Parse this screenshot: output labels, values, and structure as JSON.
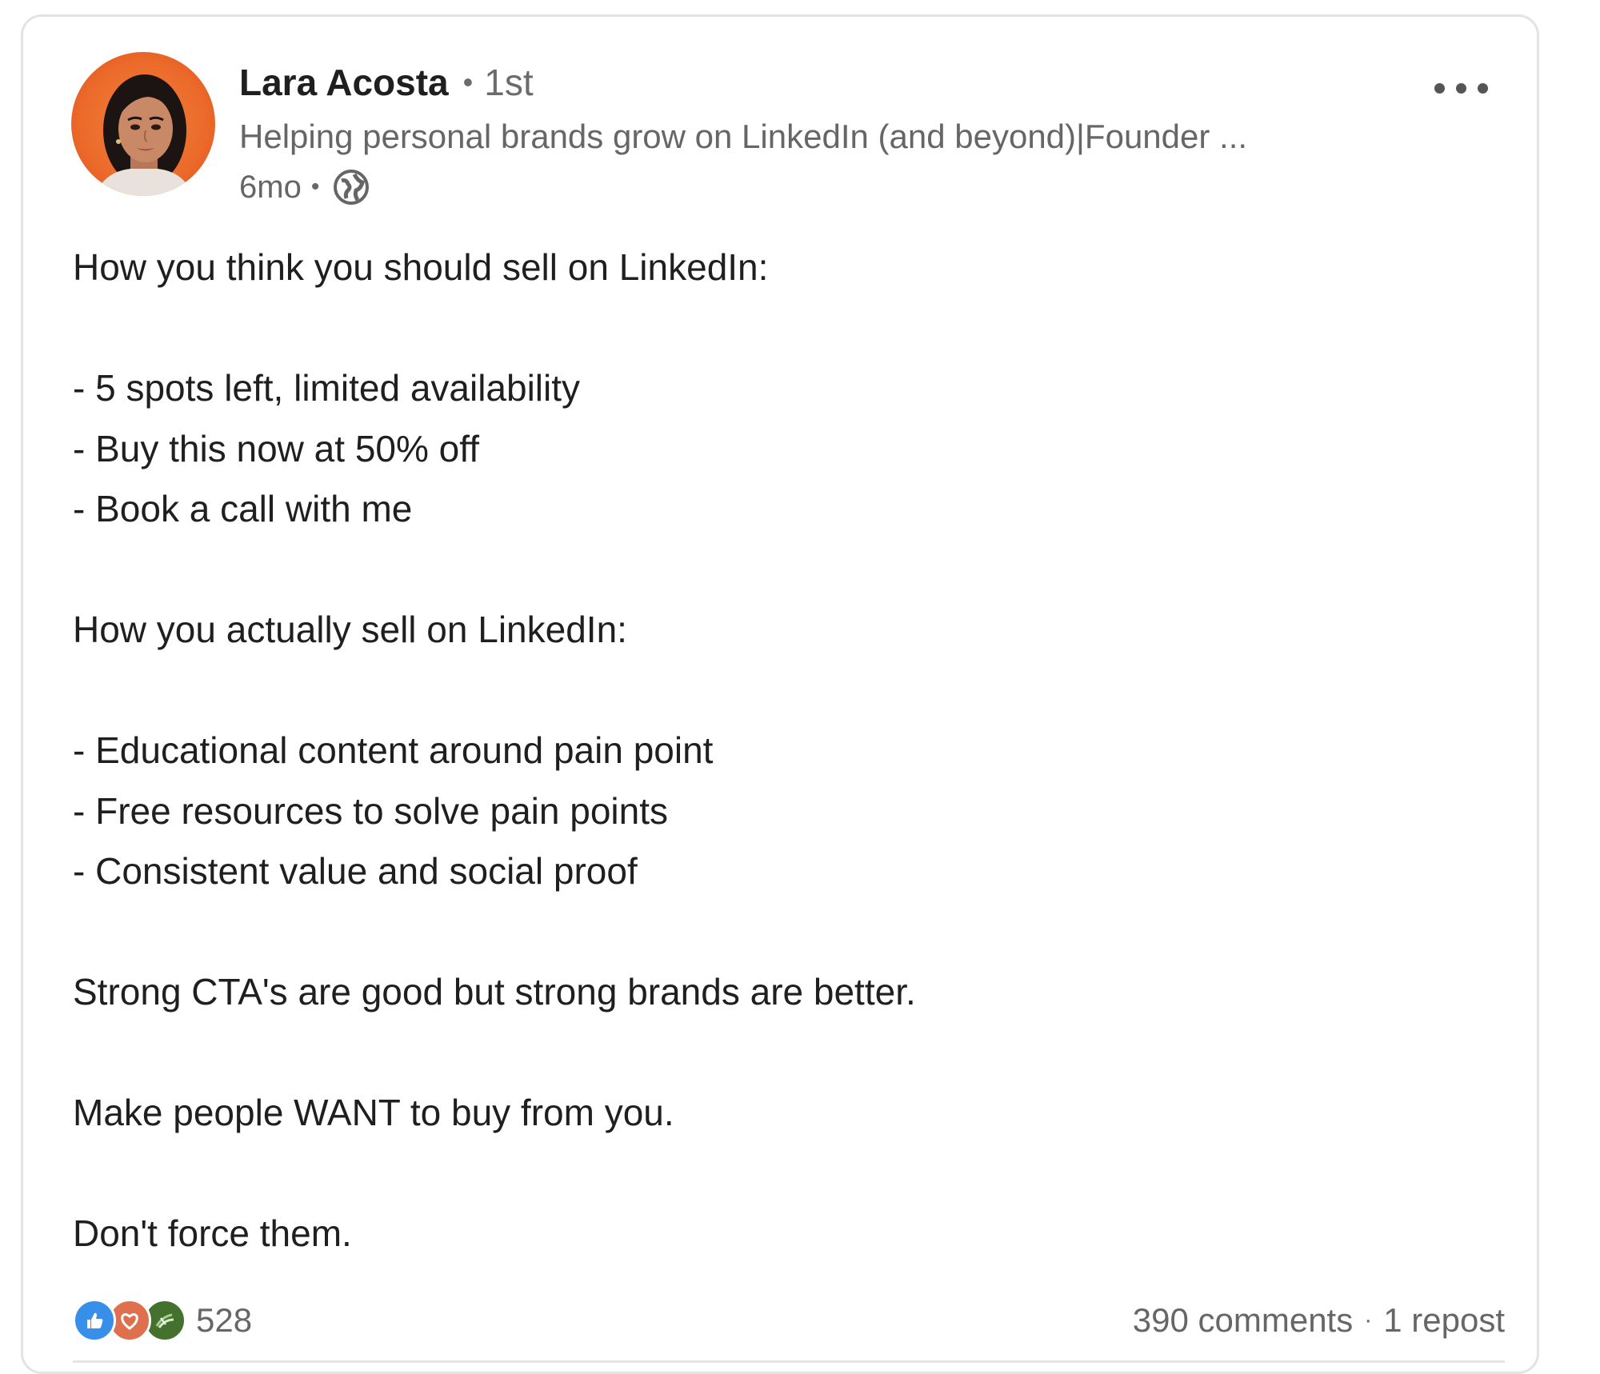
{
  "post": {
    "author": {
      "name": "Lara Acosta",
      "separator": "•",
      "connection_degree": "1st",
      "headline": "Helping personal brands grow on LinkedIn (and beyond)|Founder ...",
      "avatar_icon": "profile-photo"
    },
    "meta": {
      "time_ago": "6mo",
      "separator": "•",
      "visibility_icon": "globe-icon"
    },
    "more_menu_icon": "ellipsis-icon",
    "body_lines": {
      "l1": "How you think you should sell on LinkedIn:",
      "l2": "- 5 spots left, limited availability",
      "l3": "- Buy this now at 50% off",
      "l4": "- Book a call with me",
      "l5": "How you actually sell on LinkedIn:",
      "l6": "- Educational content around pain point",
      "l7": "- Free resources to solve pain points",
      "l8": "- Consistent value and social proof",
      "l9": "Strong CTA's are good but strong brands are better.",
      "l10": "Make people WANT to buy from you.",
      "l11": "Don't force them."
    },
    "social": {
      "reaction_icons": [
        "like-icon",
        "love-icon",
        "support-icon"
      ],
      "reaction_count": "528",
      "comments": "390 comments",
      "separator": "·",
      "reposts": "1 repost"
    },
    "colors": {
      "like": "#378fe9",
      "love": "#df704d",
      "support": "#44712e",
      "avatar_bg": "#ec6a2a"
    }
  }
}
